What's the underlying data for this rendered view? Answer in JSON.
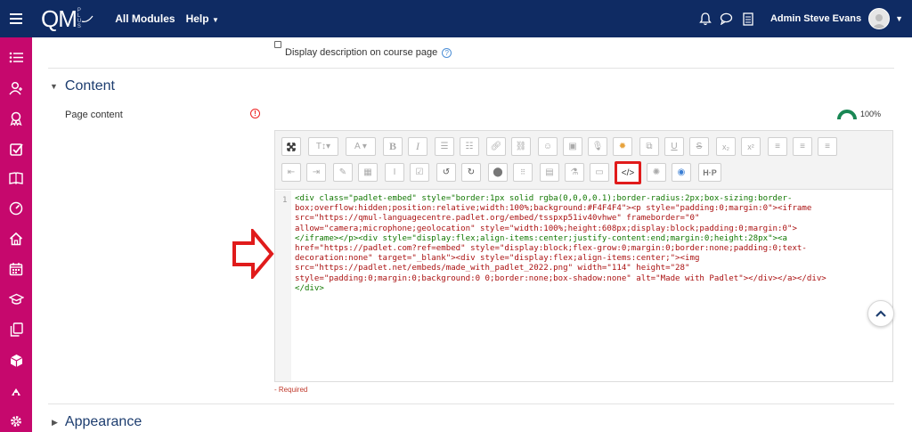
{
  "topbar": {
    "logo_main": "QM",
    "logo_sub": [
      "P",
      "L",
      "U",
      "S"
    ],
    "nav": [
      "All Modules",
      "Help"
    ],
    "user_name": "Admin Steve Evans",
    "bg_color": "#0f2b63"
  },
  "sidebar": {
    "bg_color": "#c6086d",
    "items": [
      "list-icon",
      "users-icon",
      "badge-icon",
      "checkbox-icon",
      "book-icon",
      "dashboard-icon",
      "home-icon",
      "calendar-icon",
      "graduation-icon",
      "copy-icon",
      "cube-icon",
      "chevron-up-icon",
      "gear-icon"
    ]
  },
  "form": {
    "display_description_label": "Display description on course page",
    "section_content": "Content",
    "page_content_label": "Page content",
    "progress_value": "100%",
    "required_text": "- Required",
    "section_appearance": "Appearance"
  },
  "editor": {
    "line_number": "1",
    "code_lines": [
      "<div class=\"padlet-embed\" style=\"border:1px solid rgba(0,0,0,0.1);border-radius:2px;box-sizing:border-",
      "box;overflow:hidden;position:relative;width:100%;background:#F4F4F4\"><p style=\"padding:0;margin:0\"><iframe",
      "src=\"https://qmul-languagecentre.padlet.org/embed/tsspxp51iv40vhwe\" frameborder=\"0\"",
      "allow=\"camera;microphone;geolocation\" style=\"width:100%;height:608px;display:block;padding:0;margin:0\">",
      "</iframe></p><div style=\"display:flex;align-items:center;justify-content:end;margin:0;height:28px\"><a",
      "href=\"https://padlet.com?ref=embed\" style=\"display:block;flex-grow:0;margin:0;border:none;padding:0;text-",
      "decoration:none\" target=\"_blank\"><div style=\"display:flex;align-items:center;\"><img",
      "src=\"https://padlet.net/embeds/made_with_padlet_2022.png\" width=\"114\" height=\"28\"",
      "style=\"padding:0;margin:0;background:0 0;border:none;box-shadow:none\" alt=\"Made with Padlet\"></div></a></div>",
      "</div>"
    ]
  }
}
